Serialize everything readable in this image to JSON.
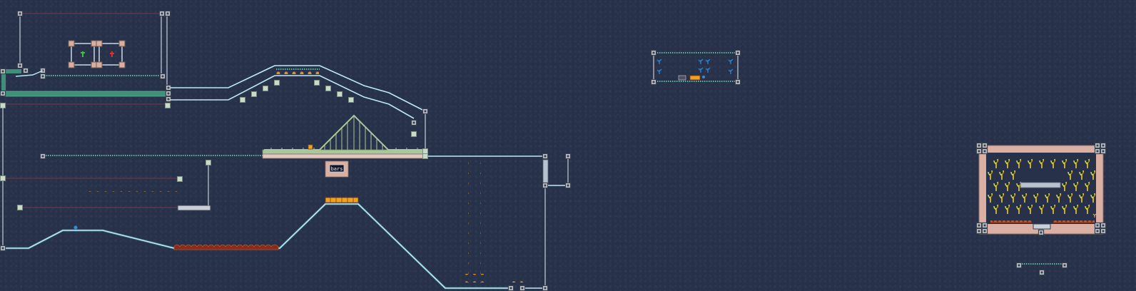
{
  "level": {
    "sign_text": "bars"
  },
  "colors": {
    "background": "#27324a",
    "terrain_line": "#bfe7f2",
    "terrain_glow": "#4fb7c9",
    "pipe": "#3f8f7a",
    "dotted_rail": "#6fe0b8",
    "frame": "#9ea8b8",
    "block": "#b9d3bf",
    "platform": "#d9b0a3",
    "bridge": "#a9c79a",
    "hazard": "#b14a2a",
    "coin": "#f2a020",
    "plant": "#e8d020"
  }
}
